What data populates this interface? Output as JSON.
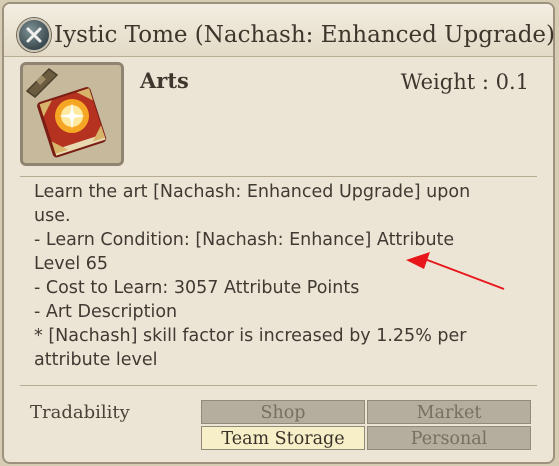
{
  "window": {
    "title": "Iystic Tome (Nachash: Enhanced Upgrade)",
    "close_icon": "close-x-icon"
  },
  "item": {
    "icon": "arts-tome-icon",
    "category": "Arts",
    "weight_label": "Weight : 0.1"
  },
  "description": {
    "lines": [
      "Learn the art [Nachash: Enhanced Upgrade] upon",
      "use.",
      "- Learn Condition: [Nachash: Enhance] Attribute",
      "Level 65",
      "- Cost to Learn: 3057 Attribute Points",
      "- Art Description",
      "* [Nachash] skill factor is increased by 1.25% per",
      "attribute level"
    ]
  },
  "tradability": {
    "label": "Tradability",
    "options": [
      {
        "label": "Shop",
        "enabled": false
      },
      {
        "label": "Market",
        "enabled": false
      },
      {
        "label": "Team Storage",
        "enabled": true
      },
      {
        "label": "Personal",
        "enabled": false
      }
    ]
  },
  "annotation": {
    "arrow_color": "#e8151a"
  }
}
